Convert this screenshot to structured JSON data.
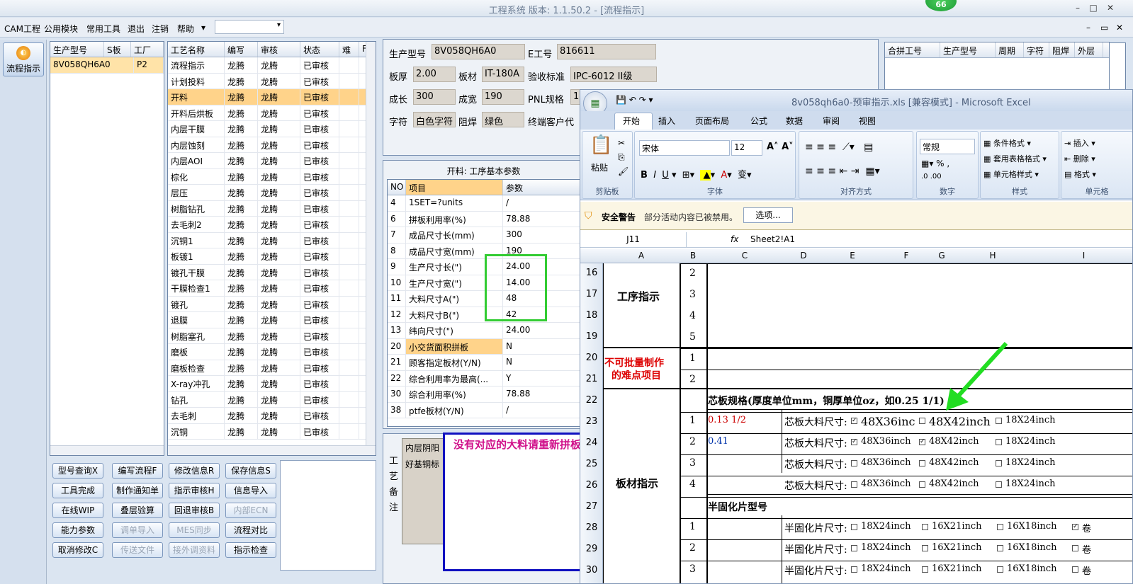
{
  "window": {
    "title": "工程系统  版本: 1.1.50.2 - [流程指示]",
    "badge": "66"
  },
  "menu": [
    "CAM工程",
    "公用模块",
    "常用工具",
    "退出",
    "注销",
    "帮助"
  ],
  "nav": {
    "flow_button": "流程指示"
  },
  "model_grid": {
    "headers": [
      "生产型号",
      "S板",
      "工厂"
    ],
    "rows": [
      [
        "8V058QH6A0",
        "",
        "P2"
      ]
    ]
  },
  "process_grid": {
    "headers": [
      "工艺名称",
      "编写",
      "审核",
      "状态",
      "难",
      "F"
    ],
    "rows": [
      [
        "流程指示",
        "龙腾",
        "龙腾",
        "已审核"
      ],
      [
        "计划投料",
        "龙腾",
        "龙腾",
        "已审核"
      ],
      [
        "开料",
        "龙腾",
        "龙腾",
        "已审核"
      ],
      [
        "开料后烘板",
        "龙腾",
        "龙腾",
        "已审核"
      ],
      [
        "内层干膜",
        "龙腾",
        "龙腾",
        "已审核"
      ],
      [
        "内层蚀刻",
        "龙腾",
        "龙腾",
        "已审核"
      ],
      [
        "内层AOI",
        "龙腾",
        "龙腾",
        "已审核"
      ],
      [
        "棕化",
        "龙腾",
        "龙腾",
        "已审核"
      ],
      [
        "层压",
        "龙腾",
        "龙腾",
        "已审核"
      ],
      [
        "树脂钻孔",
        "龙腾",
        "龙腾",
        "已审核"
      ],
      [
        "去毛刺2",
        "龙腾",
        "龙腾",
        "已审核"
      ],
      [
        "沉铜1",
        "龙腾",
        "龙腾",
        "已审核"
      ],
      [
        "板镀1",
        "龙腾",
        "龙腾",
        "已审核"
      ],
      [
        "镀孔干膜",
        "龙腾",
        "龙腾",
        "已审核"
      ],
      [
        "干膜检查1",
        "龙腾",
        "龙腾",
        "已审核"
      ],
      [
        "镀孔",
        "龙腾",
        "龙腾",
        "已审核"
      ],
      [
        "退膜",
        "龙腾",
        "龙腾",
        "已审核"
      ],
      [
        "树脂塞孔",
        "龙腾",
        "龙腾",
        "已审核"
      ],
      [
        "磨板",
        "龙腾",
        "龙腾",
        "已审核"
      ],
      [
        "磨板检查",
        "龙腾",
        "龙腾",
        "已审核"
      ],
      [
        "X-ray冲孔",
        "龙腾",
        "龙腾",
        "已审核"
      ],
      [
        "钻孔",
        "龙腾",
        "龙腾",
        "已审核"
      ],
      [
        "去毛刺",
        "龙腾",
        "龙腾",
        "已审核"
      ],
      [
        "沉铜",
        "龙腾",
        "龙腾",
        "已审核"
      ]
    ]
  },
  "buttons": [
    [
      "型号查询X",
      "编写流程F",
      "修改信息R",
      "保存信息S"
    ],
    [
      "工具完成",
      "制作通知单",
      "指示审核H",
      "信息导入"
    ],
    [
      "在线WIP",
      "叠层验算",
      "回退审核B",
      "内部ECN"
    ],
    [
      "能力参数",
      "调单导入",
      "MES同步",
      "流程对比"
    ],
    [
      "取消修改C",
      "传送文件",
      "接外调资料",
      "指示检查"
    ]
  ],
  "disabled_buttons": [
    "内部ECN",
    "调单导入",
    "MES同步",
    "传送文件",
    "接外调资料"
  ],
  "info": {
    "生产型号": "8V058QH6A0",
    "E工号": "816611",
    "板厚": "2.00",
    "板材": "IT-180A",
    "验收标准": "IPC-6012 II级",
    "成长": "300",
    "成宽": "190",
    "PNL规格": "1",
    "字符": "白色字符",
    "阻焊": "绿色",
    "终端客户代": ""
  },
  "info_labels": {
    "model": "生产型号",
    "e_no": "E工号",
    "thickness": "板厚",
    "board": "板材",
    "standard": "验收标准",
    "len": "成长",
    "wid": "成宽",
    "pnl": "PNL规格",
    "char": "字符",
    "mask": "阻焊",
    "client": "终端客户代"
  },
  "merge_grid": {
    "headers": [
      "合拼工号",
      "生产型号",
      "周期",
      "字符",
      "阻焊",
      "外层"
    ]
  },
  "params": {
    "title": "开料: 工序基本参数",
    "headers": [
      "NO",
      "项目",
      "参数"
    ],
    "rows": [
      [
        "4",
        "1SET=?units",
        "/"
      ],
      [
        "6",
        "拼板利用率(%)",
        "78.88"
      ],
      [
        "7",
        "成品尺寸长(mm)",
        "300"
      ],
      [
        "8",
        "成品尺寸宽(mm)",
        "190"
      ],
      [
        "9",
        "生产尺寸长(\")",
        "24.00"
      ],
      [
        "10",
        "生产尺寸宽(\")",
        "14.00"
      ],
      [
        "11",
        "大料尺寸A(\")",
        "48"
      ],
      [
        "12",
        "大料尺寸B(\")",
        "42"
      ],
      [
        "13",
        "纬向尺寸(\")",
        "24.00"
      ],
      [
        "20",
        "小交货面积拼板",
        "N"
      ],
      [
        "21",
        "顾客指定板材(Y/N)",
        "N"
      ],
      [
        "22",
        "综合利用率为最高(...",
        "Y"
      ],
      [
        "30",
        "综合利用率(%)",
        "78.88"
      ],
      [
        "38",
        "ptfe板材(Y/N)",
        "/"
      ]
    ]
  },
  "notes": {
    "label": "工艺备注",
    "text1": "内层阴阳",
    "text2": "好基铜标",
    "annotation": "没有对应的大料请重新拼板"
  },
  "excel": {
    "title": "8v058qh6a0-预审指示.xls [兼容模式] - Microsoft Excel",
    "tabs": [
      "开始",
      "插入",
      "页面布局",
      "公式",
      "数据",
      "审阅",
      "视图"
    ],
    "font": "宋体",
    "size": "12",
    "format": "常规",
    "groups": [
      "剪贴板",
      "字体",
      "对齐方式",
      "数字",
      "样式",
      "单元格"
    ],
    "paste": "粘贴",
    "style_items": [
      "条件格式",
      "套用表格格式",
      "单元格样式"
    ],
    "cell_items": [
      "插入",
      "删除",
      "格式"
    ],
    "security": "安全警告",
    "security_msg": "部分活动内容已被禁用。",
    "options": "选项...",
    "namebox": "J11",
    "fx": "fx",
    "formula": "Sheet2!A1",
    "columns": [
      "A",
      "B",
      "C",
      "D",
      "E",
      "F",
      "G",
      "H",
      "I"
    ],
    "row_numbers": [
      "16",
      "17",
      "18",
      "19",
      "20",
      "21",
      "22",
      "23",
      "24",
      "25",
      "26",
      "27",
      "28",
      "29",
      "30"
    ],
    "labels": {
      "process": "工序指示",
      "hard1": "不可批量制作",
      "hard2": "的难点项目",
      "board": "板材指示",
      "core": "芯板规格(厚度单位mm，铜厚单位oz，如0.25 1/1)",
      "pp": "半固化片型号"
    },
    "core_rows": [
      {
        "n": "1",
        "spec": "0.13 1/2",
        "label": "芯板大料尺寸:",
        "opts": [
          "48X36inc",
          "48X42inch",
          "18X24inch"
        ],
        "checked": [
          true,
          false,
          false
        ]
      },
      {
        "n": "2",
        "spec": "0.41",
        "label": "芯板大料尺寸:",
        "opts": [
          "48X36inch",
          "48X42inch",
          "18X24inch"
        ],
        "checked": [
          true,
          true,
          false
        ]
      },
      {
        "n": "3",
        "spec": "",
        "label": "芯板大料尺寸:",
        "opts": [
          "48X36inch",
          "48X42inch",
          "18X24inch"
        ],
        "checked": [
          false,
          false,
          false
        ]
      },
      {
        "n": "4",
        "spec": "",
        "label": "芯板大料尺寸:",
        "opts": [
          "48X36inch",
          "48X42inch",
          "18X24inch"
        ],
        "checked": [
          false,
          false,
          false
        ]
      }
    ],
    "pp_rows": [
      {
        "n": "1",
        "label": "半固化片尺寸:",
        "opts": [
          "18X24inch",
          "16X21inch",
          "16X18inch",
          "卷"
        ],
        "checked": [
          false,
          false,
          false,
          true
        ]
      },
      {
        "n": "2",
        "label": "半固化片尺寸:",
        "opts": [
          "18X24inch",
          "16X21inch",
          "16X18inch",
          "卷"
        ],
        "checked": [
          false,
          false,
          false,
          false
        ]
      },
      {
        "n": "3",
        "label": "半固化片尺寸:",
        "opts": [
          "18X24inch",
          "16X21inch",
          "16X18inch",
          "卷"
        ],
        "checked": [
          false,
          false,
          false,
          false
        ]
      }
    ],
    "proc_nums": [
      "2",
      "3",
      "4",
      "5"
    ],
    "hard_nums": [
      "1",
      "2"
    ]
  },
  "colors": {
    "accent": "#ffd38a",
    "green": "#33cc33",
    "note_border": "#1010c0",
    "note_text": "#d0108a"
  }
}
